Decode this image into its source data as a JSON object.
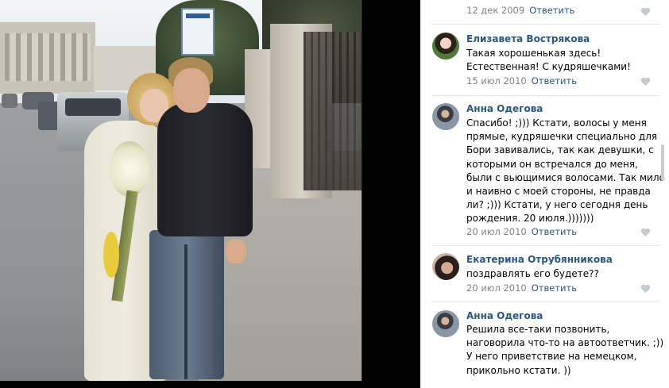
{
  "comments": [
    {
      "author": "",
      "text": "",
      "date": "12 дек 2009",
      "reply_label": "Ответить"
    },
    {
      "author": "Елизавета Вострякова",
      "text": "Такая хорошенькая здесь! Естественная! С кудряшечками!",
      "date": "15 июл 2010",
      "reply_label": "Ответить"
    },
    {
      "author": "Анна Одегова",
      "text": "Спасибо! ;))) Кстати, волосы у меня прямые, кудряшечки специально для Бори завивались, так как девушки, с которыми он встречался до меня, были с вьющимися волосами. Так мило и наивно с моей стороны, не правда ли? ;))) Кстати, у него сегодня день рождения. 20 июля.)))))))",
      "date": "20 июл 2010",
      "reply_label": "Ответить"
    },
    {
      "author": "Екатерина Отрубянникова",
      "text": "поздравлять его будете??",
      "date": "20 июл 2010",
      "reply_label": "Ответить"
    },
    {
      "author": "Анна Одегова",
      "text": "Решила все-таки позвонить, наговорила что-то на автоответчик. ;)) У него приветствие на немецком, прикольно кстати. ))",
      "date": "",
      "reply_label": ""
    }
  ],
  "colors": {
    "link": "#2a5885",
    "meta": "#828282",
    "divider": "#e7e8ec"
  },
  "icons": {
    "like": "heart-icon"
  }
}
